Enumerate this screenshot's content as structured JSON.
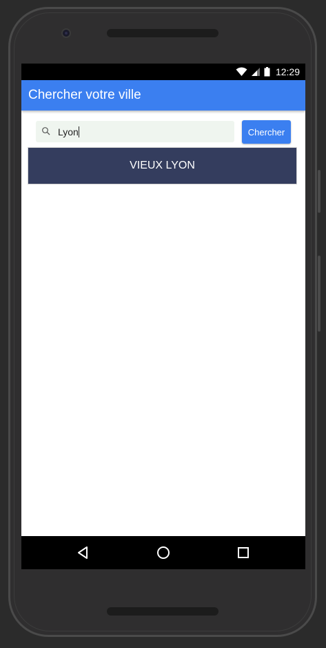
{
  "status_bar": {
    "time": "12:29",
    "icons": [
      "wifi-icon",
      "signal-icon",
      "battery-icon"
    ]
  },
  "app_bar": {
    "title": "Chercher votre ville",
    "color": "#3b7ff0"
  },
  "search": {
    "icon": "search-icon",
    "value": "Lyon",
    "button_label": "Chercher"
  },
  "results": [
    {
      "label": "VIEUX LYON"
    }
  ],
  "colors": {
    "primary": "#3b7ff0",
    "result_bg": "#343d5e",
    "search_bg": "#eff5ef"
  },
  "nav_bar": {
    "icons": [
      "back-icon",
      "home-icon",
      "recents-icon"
    ]
  }
}
